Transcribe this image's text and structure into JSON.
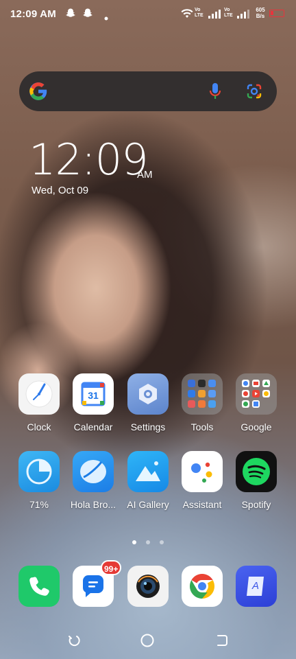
{
  "status_bar": {
    "time": "12:09 AM",
    "net_speed_value": "605",
    "net_speed_unit": "B/s",
    "volte1": "Vo\nLTE",
    "volte2": "Vo\nLTE",
    "battery_color": "#e8343c",
    "icons": [
      "snapchat-ghost-icon",
      "snapchat-ghost-icon",
      "notification-dot-icon",
      "wifi-icon",
      "volte-icon",
      "signal-icon",
      "volte-icon",
      "signal-icon",
      "battery-icon"
    ]
  },
  "search": {
    "icons": [
      "google-g-icon",
      "microphone-icon",
      "google-lens-icon"
    ]
  },
  "clock_widget": {
    "time": "12:09",
    "ampm": "AM",
    "date": "Wed, Oct 09"
  },
  "apps_row1": [
    {
      "label": "Clock",
      "icon": "clock-icon"
    },
    {
      "label": "Calendar",
      "icon": "calendar-icon",
      "day": "31"
    },
    {
      "label": "Settings",
      "icon": "settings-icon"
    },
    {
      "label": "Tools",
      "icon": "folder-icon"
    },
    {
      "label": "Google",
      "icon": "folder-icon"
    }
  ],
  "apps_row2": [
    {
      "label": "71%",
      "icon": "phone-master-icon"
    },
    {
      "label": "Hola Bro...",
      "icon": "browser-icon"
    },
    {
      "label": "AI Gallery",
      "icon": "gallery-icon"
    },
    {
      "label": "Assistant",
      "icon": "assistant-icon"
    },
    {
      "label": "Spotify",
      "icon": "spotify-icon"
    }
  ],
  "page_indicator": {
    "pages": 3,
    "current": 1
  },
  "dock": [
    {
      "icon": "phone-icon"
    },
    {
      "icon": "messages-icon",
      "badge": "99+"
    },
    {
      "icon": "camera-icon"
    },
    {
      "icon": "chrome-icon"
    },
    {
      "icon": "notes-icon",
      "letter": "A"
    }
  ],
  "navbar": {
    "icons": [
      "back-icon",
      "home-icon",
      "recents-icon"
    ]
  }
}
